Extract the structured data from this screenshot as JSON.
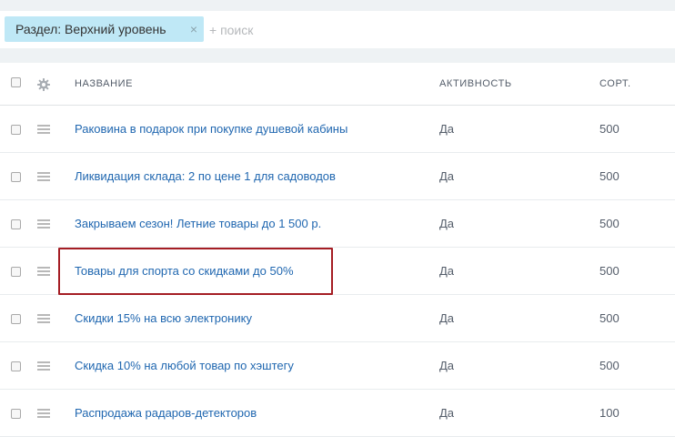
{
  "filter": {
    "chip_label": "Раздел: Верхний уровень",
    "chip_close": "×",
    "search_placeholder": "+ поиск"
  },
  "table": {
    "columns": {
      "name": "НАЗВАНИЕ",
      "active": "АКТИВНОСТЬ",
      "sort": "СОРТ."
    },
    "rows": [
      {
        "name": "Раковина в подарок при покупке душевой кабины",
        "active": "Да",
        "sort": "500"
      },
      {
        "name": "Ликвидация склада: 2 по цене 1 для садоводов",
        "active": "Да",
        "sort": "500"
      },
      {
        "name": "Закрываем сезон! Летние товары до 1 500 р.",
        "active": "Да",
        "sort": "500"
      },
      {
        "name": "Товары для спорта со скидками до 50%",
        "active": "Да",
        "sort": "500"
      },
      {
        "name": "Скидки 15% на всю электронику",
        "active": "Да",
        "sort": "500"
      },
      {
        "name": "Скидка 10% на любой товар по хэштегу",
        "active": "Да",
        "sort": "500"
      },
      {
        "name": "Распродажа радаров-детекторов",
        "active": "Да",
        "sort": "100"
      }
    ]
  },
  "colors": {
    "highlight": "#a51d24",
    "link": "#2067b0",
    "chip": "#bfe8f6"
  }
}
